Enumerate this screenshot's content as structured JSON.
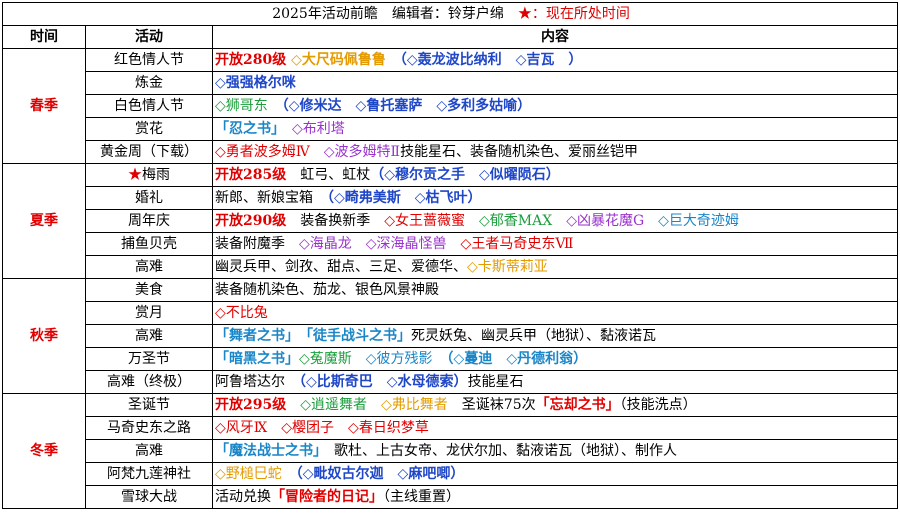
{
  "colors": {
    "red": "#e00000",
    "blue": "#1f47c8",
    "purple": "#9a32cd",
    "green": "#1a9e3c",
    "orange": "#e39b00",
    "cyan": "#1a86c8",
    "black": "#000000"
  },
  "title": {
    "main": "2025年活动前瞻　编辑者：铃芽户绵　",
    "star": "★",
    "star_note": "：现在所处时间"
  },
  "headers": {
    "time": "时间",
    "activity": "活动",
    "content": "内容"
  },
  "seasons": [
    {
      "name": "春季",
      "rows": [
        {
          "activity": "红色情人节",
          "content": [
            {
              "t": "开放280级",
              "c": "red",
              "b": true
            },
            {
              "t": " ◇大尺码佩鲁鲁",
              "c": "orange",
              "b": true
            },
            {
              "t": "　（◇轰龙波比纳利",
              "c": "blue",
              "b": true
            },
            {
              "t": "　◇吉瓦",
              "c": "blue",
              "b": true
            },
            {
              "t": "　）",
              "c": "blue",
              "b": true
            }
          ]
        },
        {
          "activity": "炼金",
          "content": [
            {
              "t": "◇强强格尔咪",
              "c": "blue",
              "b": true
            }
          ]
        },
        {
          "activity": "白色情人节",
          "content": [
            {
              "t": "◇狮哥东",
              "c": "green",
              "b": false
            },
            {
              "t": "　（◇修米达",
              "c": "blue",
              "b": true
            },
            {
              "t": "　◇鲁托塞萨",
              "c": "blue",
              "b": true
            },
            {
              "t": "　◇多利多姑喻）",
              "c": "blue",
              "b": true
            }
          ]
        },
        {
          "activity": "赏花",
          "content": [
            {
              "t": "「忍之书」",
              "c": "cyan",
              "b": true
            },
            {
              "t": "　◇布利塔",
              "c": "purple",
              "b": false
            }
          ]
        },
        {
          "activity": "黄金周（下载）",
          "content": [
            {
              "t": "◇勇者波多姆Ⅳ",
              "c": "red",
              "b": false
            },
            {
              "t": "　◇波多姆特Ⅱ",
              "c": "purple",
              "b": false
            },
            {
              "t": "技能星石、装备随机染色、爱丽丝铠甲",
              "c": "black",
              "b": false
            }
          ]
        }
      ]
    },
    {
      "name": "夏季",
      "rows": [
        {
          "activity": "梅雨",
          "star": "★",
          "content": [
            {
              "t": "开放285级",
              "c": "red",
              "b": true
            },
            {
              "t": "　虹弓、虹杖",
              "c": "black",
              "b": false
            },
            {
              "t": "（◇穆尔贡之手",
              "c": "blue",
              "b": true
            },
            {
              "t": "　◇似曜陨石）",
              "c": "blue",
              "b": true
            }
          ]
        },
        {
          "activity": "婚礼",
          "content": [
            {
              "t": "新郎、新娘宝箱",
              "c": "black",
              "b": false
            },
            {
              "t": "　（◇畸弗美斯",
              "c": "blue",
              "b": true
            },
            {
              "t": "　◇枯飞叶）",
              "c": "blue",
              "b": true
            }
          ]
        },
        {
          "activity": "周年庆",
          "content": [
            {
              "t": "开放290级",
              "c": "red",
              "b": true
            },
            {
              "t": "　装备换新季",
              "c": "black",
              "b": false
            },
            {
              "t": "　◇女王蔷薇蜜",
              "c": "red",
              "b": false
            },
            {
              "t": "　◇郁香MAX",
              "c": "green",
              "b": false
            },
            {
              "t": "　◇凶暴花魔G",
              "c": "purple",
              "b": false
            },
            {
              "t": "　◇巨大奇迹姆",
              "c": "cyan",
              "b": false
            }
          ]
        },
        {
          "activity": "捕鱼贝壳",
          "content": [
            {
              "t": "装备附魔季",
              "c": "black",
              "b": false
            },
            {
              "t": "　◇海晶龙",
              "c": "purple",
              "b": false
            },
            {
              "t": "　◇深海晶怪兽",
              "c": "purple",
              "b": false
            },
            {
              "t": "　◇王者马奇史东Ⅶ",
              "c": "red",
              "b": false
            }
          ]
        },
        {
          "activity": "高难",
          "content": [
            {
              "t": "幽灵兵甲、剑孜、甜点、三足、爱德华、",
              "c": "black",
              "b": false
            },
            {
              "t": "◇卡斯蒂莉亚",
              "c": "orange",
              "b": false
            }
          ]
        }
      ]
    },
    {
      "name": "秋季",
      "rows": [
        {
          "activity": "美食",
          "content": [
            {
              "t": "装备随机染色、茄龙、银色风景神殿",
              "c": "black",
              "b": false
            }
          ]
        },
        {
          "activity": "赏月",
          "content": [
            {
              "t": "◇不比兔",
              "c": "red",
              "b": false
            }
          ]
        },
        {
          "activity": "高难",
          "content": [
            {
              "t": "「舞者之书」",
              "c": "cyan",
              "b": true
            },
            {
              "t": "　「徒手战斗之书」",
              "c": "cyan",
              "b": true
            },
            {
              "t": "死灵妖兔、幽灵兵甲（地狱）、黏液诺瓦",
              "c": "black",
              "b": false
            }
          ]
        },
        {
          "activity": "万圣节",
          "content": [
            {
              "t": "「暗黑之书」",
              "c": "cyan",
              "b": true
            },
            {
              "t": "◇菟魔斯",
              "c": "green",
              "b": false
            },
            {
              "t": "　◇彼方残影",
              "c": "cyan",
              "b": false
            },
            {
              "t": "　（◇蔓迪",
              "c": "cyan",
              "b": true
            },
            {
              "t": "　◇丹德利翁）",
              "c": "cyan",
              "b": true
            }
          ]
        },
        {
          "activity": "高难（终极）",
          "content": [
            {
              "t": "阿鲁塔达尔",
              "c": "black",
              "b": false
            },
            {
              "t": "　（◇比斯奇巴",
              "c": "blue",
              "b": true
            },
            {
              "t": "　◇水母德索）",
              "c": "blue",
              "b": true
            },
            {
              "t": "技能星石",
              "c": "black",
              "b": false
            }
          ]
        }
      ]
    },
    {
      "name": "冬季",
      "rows": [
        {
          "activity": "圣诞节",
          "content": [
            {
              "t": "开放295级",
              "c": "red",
              "b": true
            },
            {
              "t": "　◇逍遥舞者",
              "c": "green",
              "b": false
            },
            {
              "t": "　◇弗比舞者",
              "c": "orange",
              "b": false
            },
            {
              "t": "　圣诞袜75次",
              "c": "black",
              "b": false
            },
            {
              "t": "「忘却之书」",
              "c": "red",
              "b": true
            },
            {
              "t": "（技能洗点）",
              "c": "black",
              "b": false
            }
          ]
        },
        {
          "activity": "马奇史东之路",
          "content": [
            {
              "t": "◇风牙Ⅸ",
              "c": "red",
              "b": false
            },
            {
              "t": "　◇樱团子",
              "c": "red",
              "b": false
            },
            {
              "t": "　◇春日织梦草",
              "c": "red",
              "b": false
            }
          ]
        },
        {
          "activity": "高难",
          "content": [
            {
              "t": "「魔法战士之书」",
              "c": "cyan",
              "b": true
            },
            {
              "t": "　歌杜、上古女帝、龙伏尔加、黏液诺瓦（地狱）、制作人",
              "c": "black",
              "b": false
            }
          ]
        },
        {
          "activity": "阿梵九莲神社",
          "content": [
            {
              "t": "◇野槌巳蛇",
              "c": "orange",
              "b": false
            },
            {
              "t": "　（◇毗奴古尔迦",
              "c": "blue",
              "b": true
            },
            {
              "t": "　◇麻吧唧）",
              "c": "blue",
              "b": true
            }
          ]
        },
        {
          "activity": "雪球大战",
          "content": [
            {
              "t": "活动兑换",
              "c": "black",
              "b": false
            },
            {
              "t": "「冒险者的日记」",
              "c": "red",
              "b": true
            },
            {
              "t": "（主线重置）",
              "c": "black",
              "b": false
            }
          ]
        }
      ]
    }
  ]
}
